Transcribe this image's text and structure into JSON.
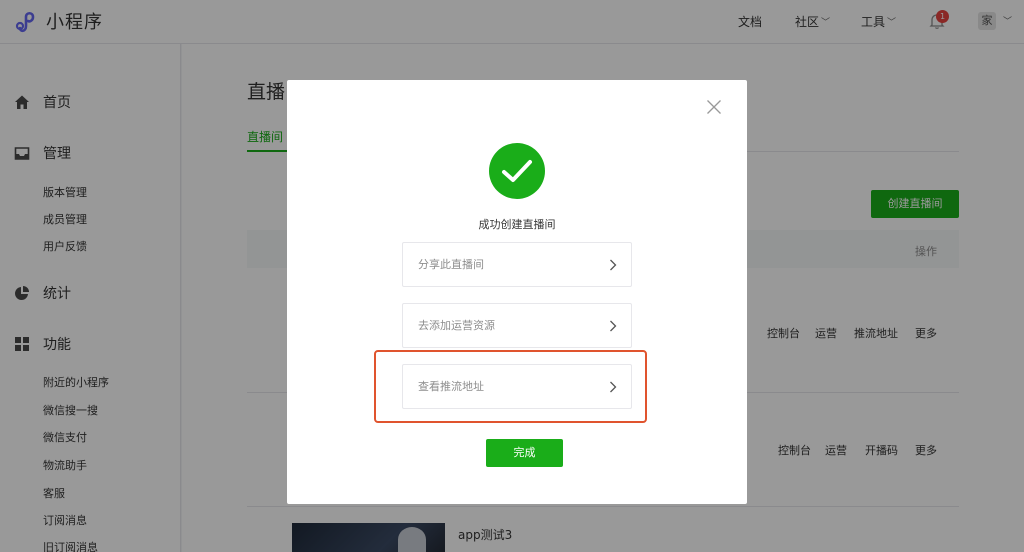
{
  "header": {
    "app_name": "小程序",
    "nav": [
      {
        "label": "文档"
      },
      {
        "label": "社区"
      },
      {
        "label": "工具"
      }
    ],
    "notification_count": "1",
    "avatar_text": "家"
  },
  "sidebar": {
    "sections": [
      {
        "label": "首页",
        "icon": "home-icon"
      },
      {
        "label": "管理",
        "icon": "inbox-icon",
        "items": [
          "版本管理",
          "成员管理",
          "用户反馈"
        ]
      },
      {
        "label": "统计",
        "icon": "pie-chart-icon"
      },
      {
        "label": "功能",
        "icon": "grid-icon",
        "items": [
          "附近的小程序",
          "微信搜一搜",
          "微信支付",
          "物流助手",
          "客服",
          "订阅消息",
          "旧订阅消息"
        ]
      }
    ]
  },
  "main": {
    "page_title": "直播",
    "active_tab": "直播间",
    "create_button": "创建直播间",
    "ops_header": "操作",
    "rows": [
      {
        "actions": [
          "控制台",
          "运营",
          "推流地址",
          "更多"
        ]
      },
      {
        "actions": [
          "控制台",
          "运营",
          "开播码",
          "更多"
        ]
      },
      {
        "title": "app测试3"
      }
    ]
  },
  "modal": {
    "success_text": "成功创建直播间",
    "options": [
      "分享此直播间",
      "去添加运营资源",
      "查看推流地址"
    ],
    "done_button": "完成"
  },
  "colors": {
    "accent_green": "#1aad19",
    "highlight_red": "#e0542e",
    "badge_red": "#e64340"
  }
}
